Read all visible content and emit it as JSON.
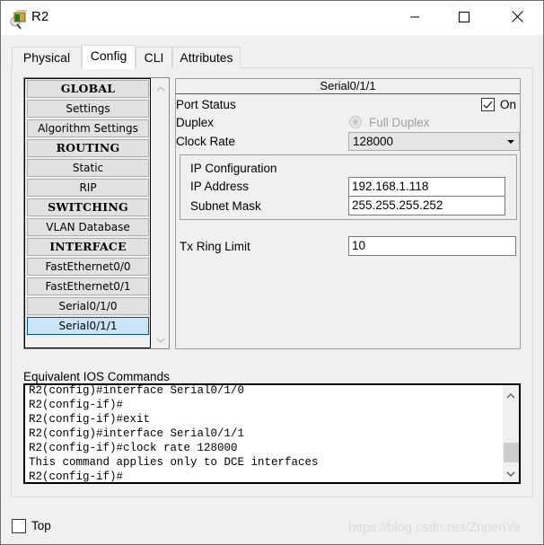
{
  "window": {
    "title": "R2",
    "icon": "router-device-icon",
    "controls": {
      "minimize": "minimize-icon",
      "maximize": "maximize-icon",
      "close": "close-icon"
    }
  },
  "tabs": [
    {
      "label": "Physical",
      "active": false
    },
    {
      "label": "Config",
      "active": true
    },
    {
      "label": "CLI",
      "active": false
    },
    {
      "label": "Attributes",
      "active": false
    }
  ],
  "sidebar": {
    "items": [
      {
        "label": "GLOBAL",
        "type": "header"
      },
      {
        "label": "Settings",
        "type": "item"
      },
      {
        "label": "Algorithm Settings",
        "type": "item"
      },
      {
        "label": "ROUTING",
        "type": "header"
      },
      {
        "label": "Static",
        "type": "item"
      },
      {
        "label": "RIP",
        "type": "item"
      },
      {
        "label": "SWITCHING",
        "type": "header"
      },
      {
        "label": "VLAN Database",
        "type": "item"
      },
      {
        "label": "INTERFACE",
        "type": "header"
      },
      {
        "label": "FastEthernet0/0",
        "type": "item"
      },
      {
        "label": "FastEthernet0/1",
        "type": "item"
      },
      {
        "label": "Serial0/1/0",
        "type": "item"
      },
      {
        "label": "Serial0/1/1",
        "type": "item",
        "selected": true
      }
    ]
  },
  "interface": {
    "title": "Serial0/1/1",
    "port_status": {
      "label": "Port Status",
      "checked": true,
      "value_label": "On"
    },
    "duplex": {
      "label": "Duplex",
      "value_label": "Full Duplex",
      "disabled": true
    },
    "clock_rate": {
      "label": "Clock Rate",
      "value": "128000"
    },
    "ip_config": {
      "title": "IP Configuration",
      "ip_address": {
        "label": "IP Address",
        "value": "192.168.1.118"
      },
      "subnet_mask": {
        "label": "Subnet Mask",
        "value": "255.255.255.252"
      }
    },
    "tx_ring_limit": {
      "label": "Tx Ring Limit",
      "value": "10"
    }
  },
  "ios": {
    "label": "Equivalent IOS Commands",
    "lines": [
      "R2(config)#interface Serial0/1/0",
      "R2(config-if)#",
      "R2(config-if)#exit",
      "R2(config)#interface Serial0/1/1",
      "R2(config-if)#clock rate 128000",
      "This command applies only to DCE interfaces",
      "R2(config-if)#"
    ]
  },
  "footer": {
    "top_label": "Top",
    "top_checked": false,
    "watermark": "https://blog.csdn.net/ZripenYe"
  }
}
